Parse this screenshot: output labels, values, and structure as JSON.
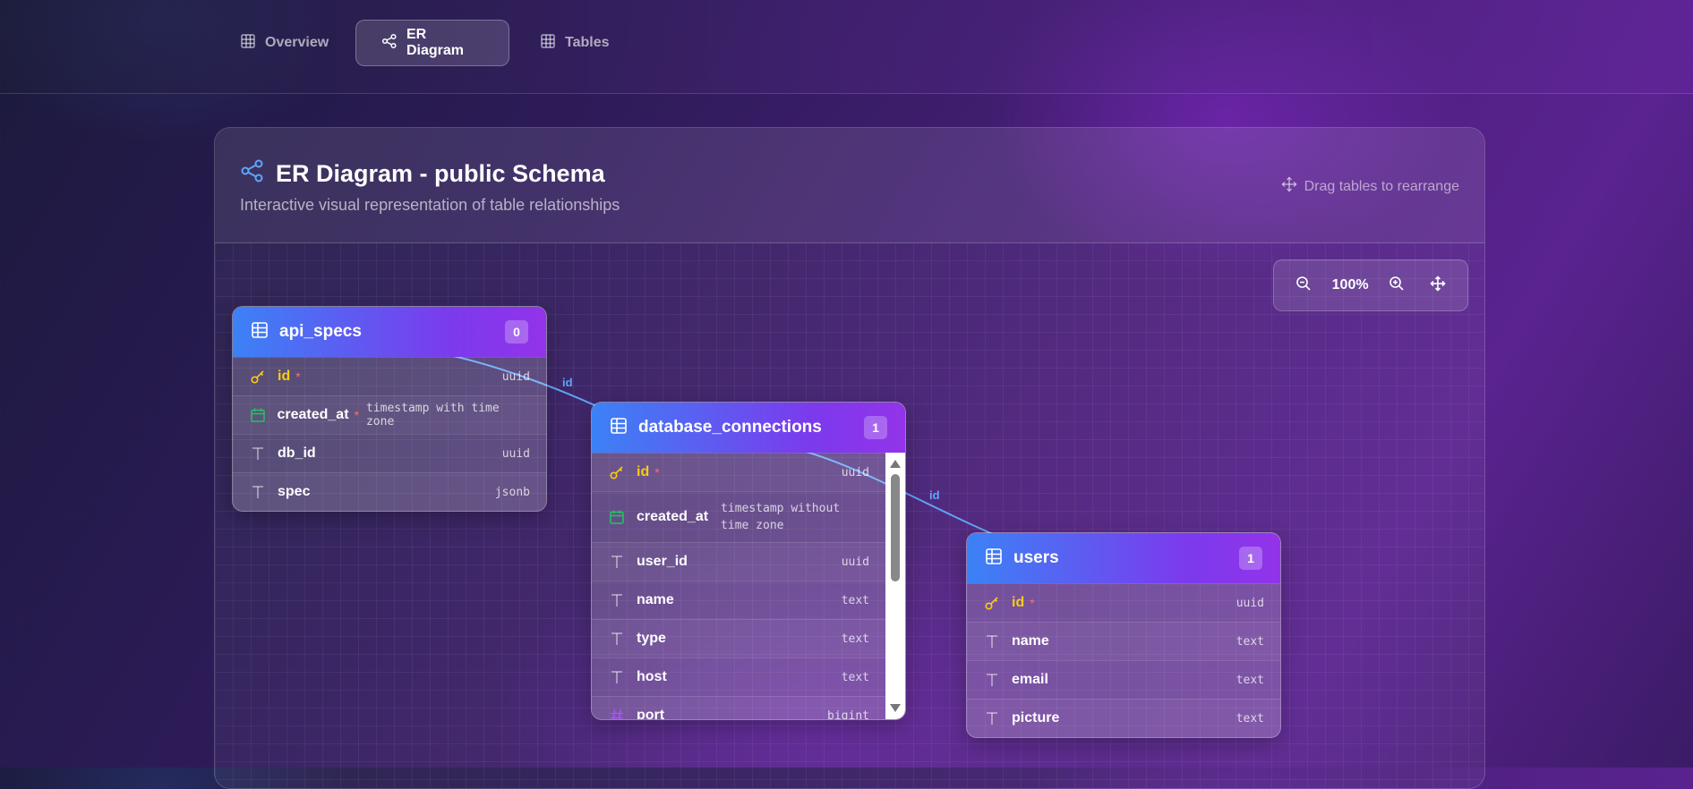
{
  "nav": {
    "tabs": [
      {
        "label": "Overview",
        "icon": "grid-icon",
        "active": false
      },
      {
        "label": "ER Diagram",
        "icon": "share-nodes-icon",
        "active": true
      },
      {
        "label": "Tables",
        "icon": "table-icon",
        "active": false
      }
    ]
  },
  "panel": {
    "title": "ER Diagram - public Schema",
    "subtitle": "Interactive visual representation of table relationships",
    "drag_hint": "Drag tables to rearrange"
  },
  "zoom": {
    "value": "100%"
  },
  "colors": {
    "header_gradient_start": "#3b82f6",
    "header_gradient_end": "#9333ea",
    "primary_key": "#facc15",
    "required_marker": "#f87171",
    "edge": "#60a5fa",
    "date_icon": "#22c55e",
    "number_icon": "#a855f7"
  },
  "tables": [
    {
      "name": "api_specs",
      "count": "0",
      "columns": [
        {
          "name": "id",
          "type": "uuid",
          "icon": "key-icon",
          "pk": true,
          "required": true
        },
        {
          "name": "created_at",
          "type": "timestamp with time zone",
          "icon": "calendar-icon",
          "pk": false,
          "required": true
        },
        {
          "name": "db_id",
          "type": "uuid",
          "icon": "text-icon",
          "pk": false,
          "required": false
        },
        {
          "name": "spec",
          "type": "jsonb",
          "icon": "text-icon",
          "pk": false,
          "required": false
        }
      ]
    },
    {
      "name": "database_connections",
      "count": "1",
      "columns": [
        {
          "name": "id",
          "type": "uuid",
          "icon": "key-icon",
          "pk": true,
          "required": true
        },
        {
          "name": "created_at",
          "type": "timestamp without time zone",
          "icon": "calendar-icon",
          "pk": false,
          "required": true
        },
        {
          "name": "user_id",
          "type": "uuid",
          "icon": "text-icon",
          "pk": false,
          "required": false
        },
        {
          "name": "name",
          "type": "text",
          "icon": "text-icon",
          "pk": false,
          "required": false
        },
        {
          "name": "type",
          "type": "text",
          "icon": "text-icon",
          "pk": false,
          "required": false
        },
        {
          "name": "host",
          "type": "text",
          "icon": "text-icon",
          "pk": false,
          "required": false
        },
        {
          "name": "port",
          "type": "bigint",
          "icon": "hash-icon",
          "pk": false,
          "required": false
        }
      ]
    },
    {
      "name": "users",
      "count": "1",
      "columns": [
        {
          "name": "id",
          "type": "uuid",
          "icon": "key-icon",
          "pk": true,
          "required": true
        },
        {
          "name": "name",
          "type": "text",
          "icon": "text-icon",
          "pk": false,
          "required": false
        },
        {
          "name": "email",
          "type": "text",
          "icon": "text-icon",
          "pk": false,
          "required": false
        },
        {
          "name": "picture",
          "type": "text",
          "icon": "text-icon",
          "pk": false,
          "required": false
        }
      ]
    }
  ],
  "relations": [
    {
      "label": "id",
      "from": "api_specs",
      "to": "database_connections"
    },
    {
      "label": "id",
      "from": "database_connections",
      "to": "users"
    }
  ]
}
